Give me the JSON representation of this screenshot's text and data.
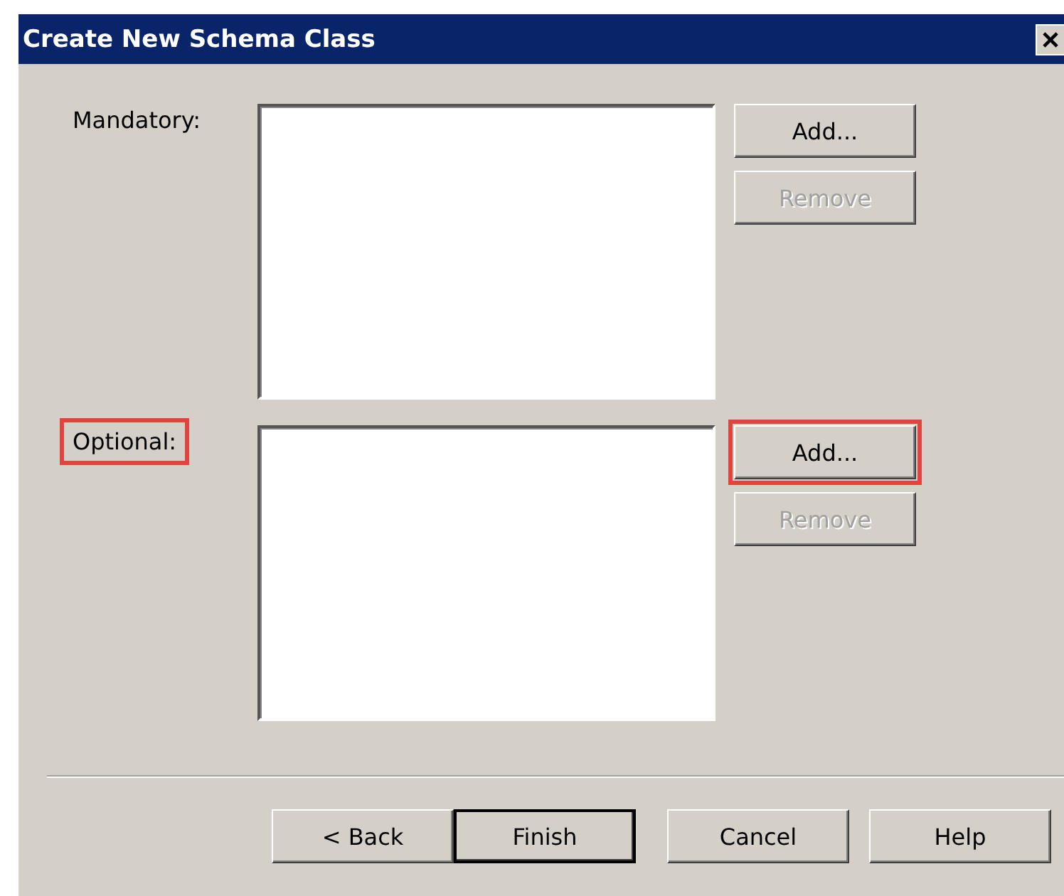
{
  "window": {
    "title": "Create New Schema Class"
  },
  "sections": [
    {
      "label": "Mandatory:",
      "label_highlighted": false,
      "buttons": [
        {
          "label": "Add...",
          "disabled": false,
          "highlighted": false
        },
        {
          "label": "Remove",
          "disabled": true,
          "highlighted": false
        }
      ]
    },
    {
      "label": "Optional:",
      "label_highlighted": true,
      "buttons": [
        {
          "label": "Add...",
          "disabled": false,
          "highlighted": true
        },
        {
          "label": "Remove",
          "disabled": true,
          "highlighted": false
        }
      ]
    }
  ],
  "footer_buttons": [
    {
      "label": "< Back",
      "default": false
    },
    {
      "label": "Finish",
      "default": true
    },
    {
      "label": "Cancel",
      "default": false
    },
    {
      "label": "Help",
      "default": false
    }
  ]
}
